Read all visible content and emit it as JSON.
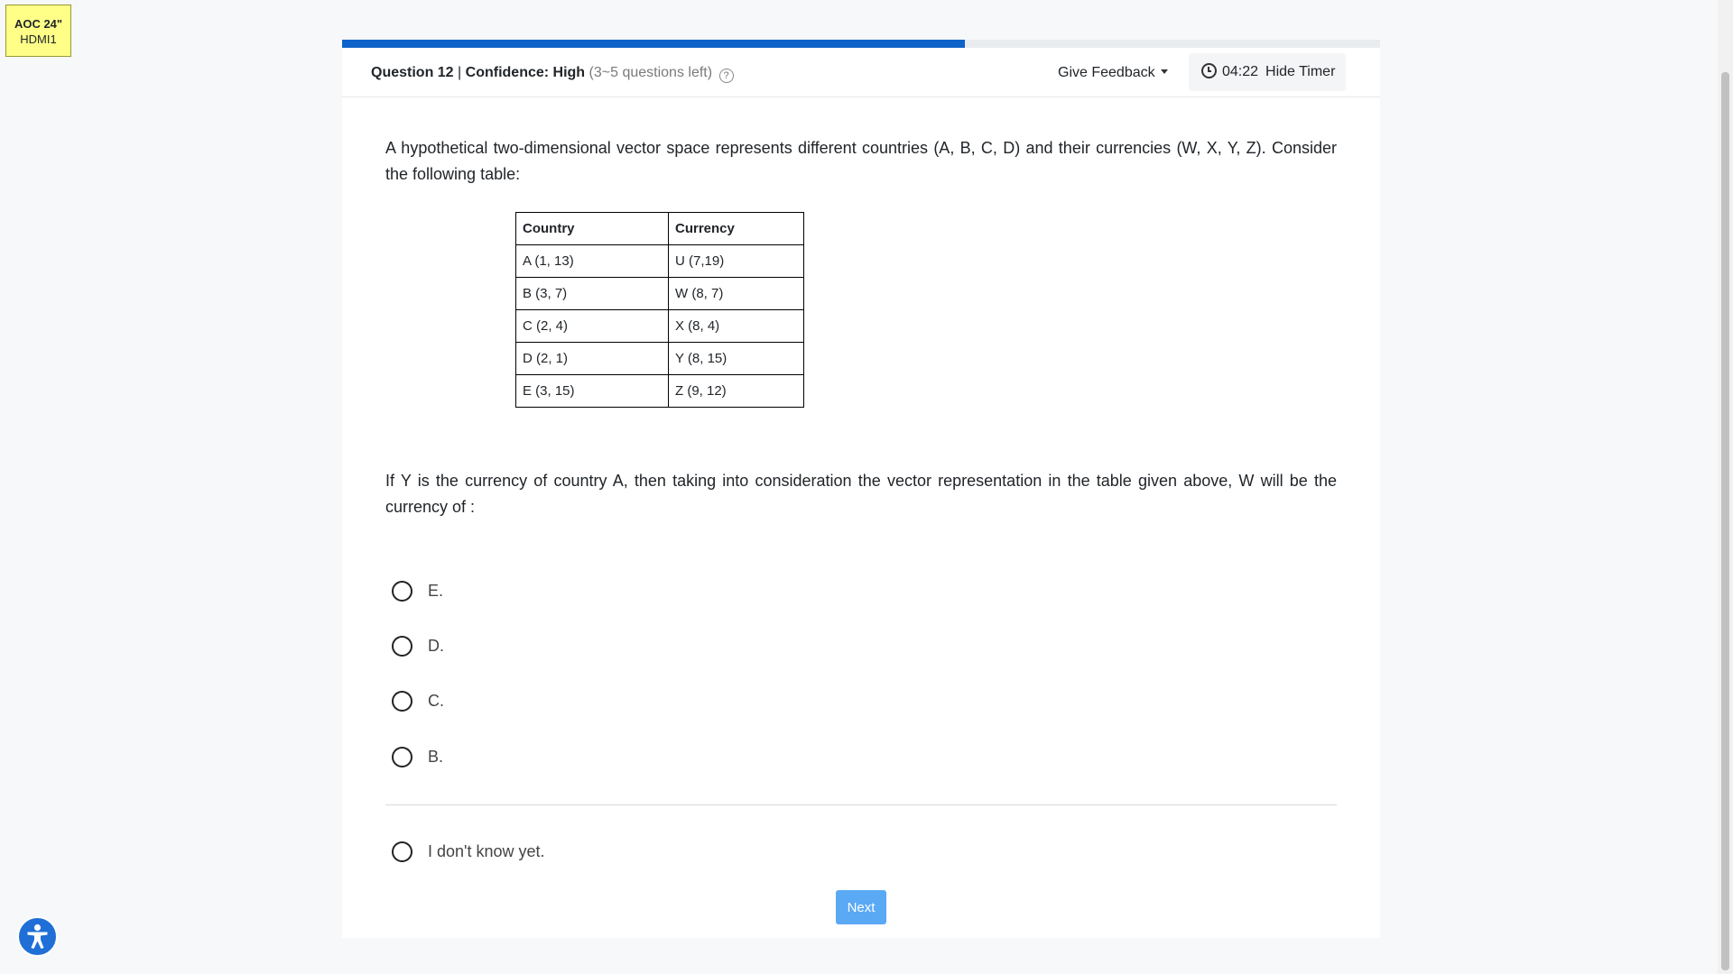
{
  "sticker": {
    "line1": "AOC 24\"",
    "line2": "HDMI1"
  },
  "progress": {
    "percent": 60
  },
  "header": {
    "question_label": "Question 12",
    "separator1": "|",
    "confidence_label": "Confidence: High",
    "questions_left": "(3~5 questions left)",
    "help_glyph": "?",
    "feedback_label": "Give Feedback",
    "timer_value": "04:22",
    "hide_timer_label": "Hide Timer"
  },
  "question": {
    "intro": "A hypothetical two-dimensional vector space represents different countries (A, B, C, D) and their currencies (W, X, Y, Z). Consider the following table:",
    "table": {
      "headers": [
        "Country",
        "Currency"
      ],
      "rows": [
        [
          "A (1, 13)",
          "U (7,19)"
        ],
        [
          "B (3, 7)",
          "W (8, 7)"
        ],
        [
          "C (2, 4)",
          "X (8, 4)"
        ],
        [
          "D (2, 1)",
          "Y (8, 15)"
        ],
        [
          "E (3, 15)",
          "Z (9, 12)"
        ]
      ]
    },
    "prompt": "If Y is the currency of country A, then taking into consideration the vector representation in the table given above, W will be the currency of :"
  },
  "options": [
    "E.",
    "D.",
    "C.",
    "B."
  ],
  "dont_know_label": "I don't know yet.",
  "next_label": "Next",
  "colors": {
    "accent": "#0d63c9",
    "next_button": "#5aa9f5",
    "sticker": "#ffff88"
  },
  "icons": {
    "help": "help-circle-icon",
    "timer": "clock-icon",
    "dropdown": "caret-down-icon",
    "accessibility": "accessibility-icon"
  }
}
